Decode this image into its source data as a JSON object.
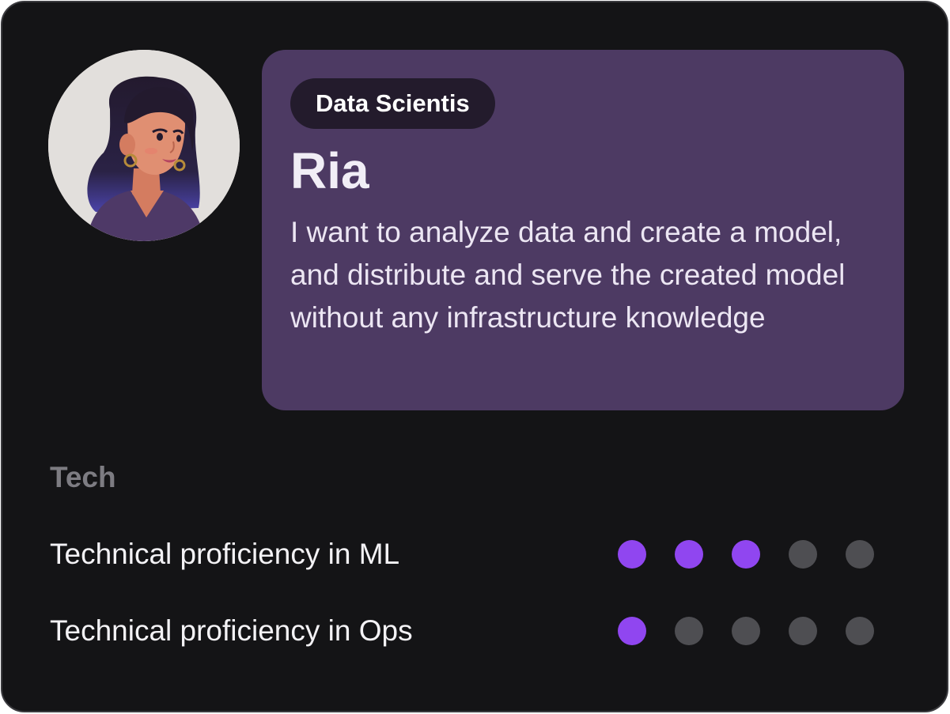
{
  "persona": {
    "role": "Data Scientis",
    "name": "Ria",
    "description": "I want to analyze data and create a model, and distribute and serve the created model without any infrastructure knowledge",
    "avatar_icon": "woman-avatar-icon"
  },
  "tech_section": {
    "label": "Tech",
    "skills": [
      {
        "label": "Technical proficiency in ML",
        "level": 3,
        "max": 5
      },
      {
        "label": "Technical proficiency in Ops",
        "level": 1,
        "max": 5
      }
    ]
  },
  "colors": {
    "card_background": "#141416",
    "bubble_background": "#4d3a63",
    "pill_background": "#231b2c",
    "dot_filled": "#9046f0",
    "dot_empty": "#4e4e52"
  }
}
